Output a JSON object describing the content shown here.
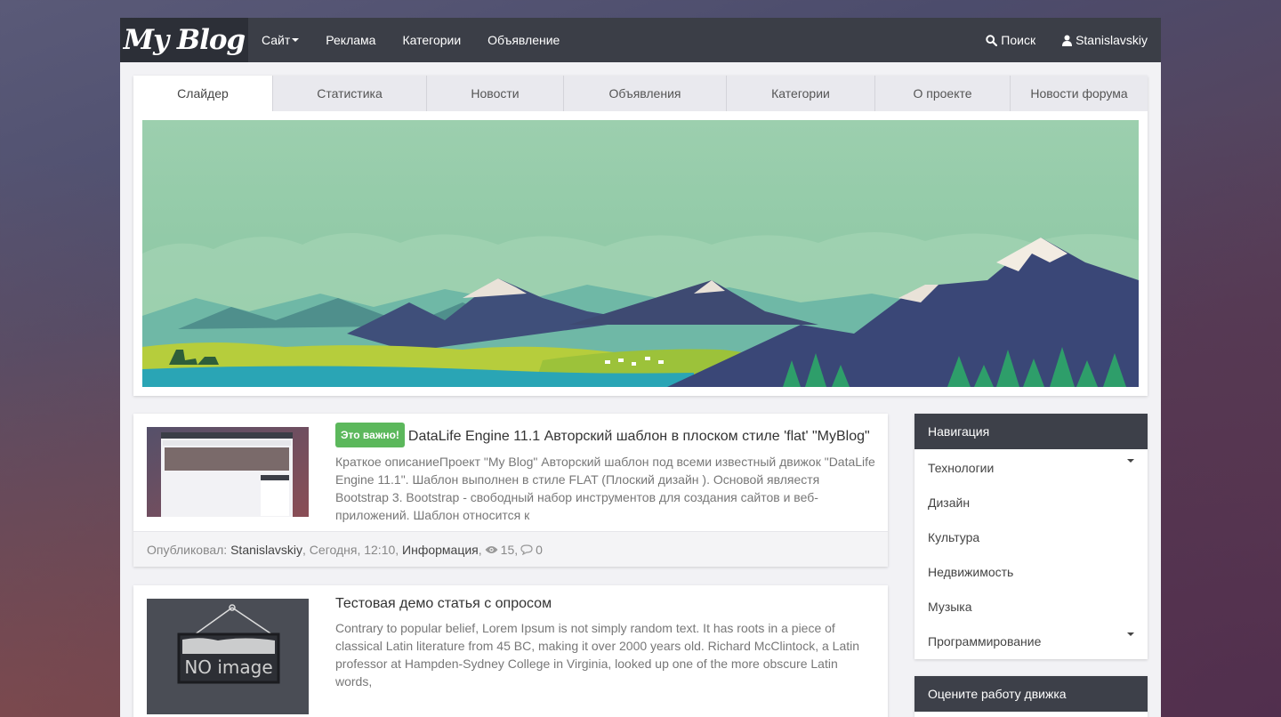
{
  "header": {
    "logo": "My Blog",
    "nav": [
      "Сайт",
      "Реклама",
      "Категории",
      "Объявление"
    ],
    "search_label": "Поиск",
    "user_label": "Stanislavskiy"
  },
  "tabs": [
    {
      "label": "Слайдер",
      "active": true
    },
    {
      "label": "Статистика",
      "active": false
    },
    {
      "label": "Новости",
      "active": false
    },
    {
      "label": "Объявления",
      "active": false
    },
    {
      "label": "Категории",
      "active": false
    },
    {
      "label": "О проекте",
      "active": false
    },
    {
      "label": "Новости форума",
      "active": false
    }
  ],
  "articles": [
    {
      "badge": "Это важно!",
      "title": "DataLife Engine 11.1 Авторский шаблон в плоском стиле 'flat' \"MyBlog\"",
      "excerpt": "Краткое описаниеПроект \"My Blog\" Авторский шаблон под всеми известный движок \"DataLife Engine 11.1\". Шаблон выполнен в стиле FLAT (Плоский дизайн ). Основой являестя Bootstrap 3.  Bootstrap - свободный набор инструментов для создания сайтов и веб-приложений.  Шаблон относится к",
      "meta": {
        "published_label": "Опубликовал:",
        "author": "Stanislavskiy",
        "date": "Сегодня, 12:10",
        "category": "Информация",
        "views": "15",
        "comments": "0"
      }
    },
    {
      "title": "Тестовая демо статья с опросом",
      "excerpt": "Contrary to popular belief, Lorem Ipsum is not simply random text. It has roots in a piece of classical Latin literature from 45 BC, making it over 2000 years old. Richard McClintock, a Latin professor at Hampden-Sydney College in Virginia, looked up one of the more obscure Latin words,",
      "thumb_text": "NO image"
    }
  ],
  "sidebar": {
    "nav_title": "Навигация",
    "nav_items": [
      {
        "label": "Технологии",
        "dropdown": true
      },
      {
        "label": "Дизайн",
        "dropdown": false
      },
      {
        "label": "Культура",
        "dropdown": false
      },
      {
        "label": "Недвижимость",
        "dropdown": false
      },
      {
        "label": "Музыка",
        "dropdown": false
      },
      {
        "label": "Программирование",
        "dropdown": true
      }
    ],
    "rate_title": "Оцените работу движка"
  },
  "colors": {
    "header": "#3b3e47",
    "badge": "#5cb85c",
    "sky": "#8fc7a3"
  }
}
